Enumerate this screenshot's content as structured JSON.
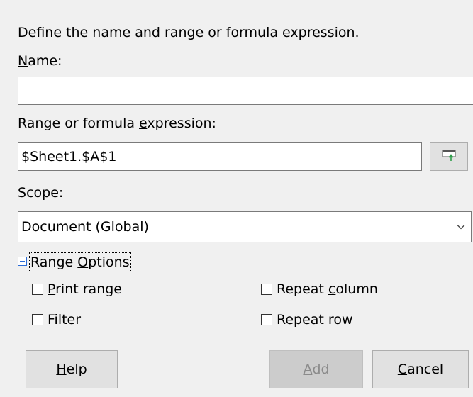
{
  "intro": "Define the name and range or formula expression.",
  "name": {
    "label_accel": "N",
    "label_rest": "ame:",
    "value": ""
  },
  "range": {
    "label_pre": "Range or formula ",
    "label_accel": "e",
    "label_post": "xpression:",
    "value": "$Sheet1.$A$1",
    "shrink_icon": "shrink-selection-icon"
  },
  "scope": {
    "label_accel": "S",
    "label_rest": "cope:",
    "value": "Document (Global)",
    "arrow_icon": "chevron-down-icon"
  },
  "range_options": {
    "title_pre": "Range ",
    "title_accel": "O",
    "title_post": "ptions",
    "print_range": {
      "accel": "P",
      "rest": "rint range",
      "checked": false
    },
    "filter": {
      "accel": "F",
      "rest": "ilter",
      "checked": false
    },
    "repeat_column": {
      "pre": "Repeat ",
      "accel": "c",
      "post": "olumn",
      "checked": false
    },
    "repeat_row": {
      "pre": "Repeat ",
      "accel": "r",
      "post": "ow",
      "checked": false
    }
  },
  "buttons": {
    "help": {
      "accel": "H",
      "rest": "elp"
    },
    "add": {
      "accel": "A",
      "rest": "dd",
      "disabled": true
    },
    "cancel": {
      "accel": "C",
      "rest": "ancel"
    }
  },
  "colors": {
    "background": "#f0f0f0",
    "expander_accent": "#2b6cd6",
    "shrink_icon_accent": "#2e9e4a"
  }
}
